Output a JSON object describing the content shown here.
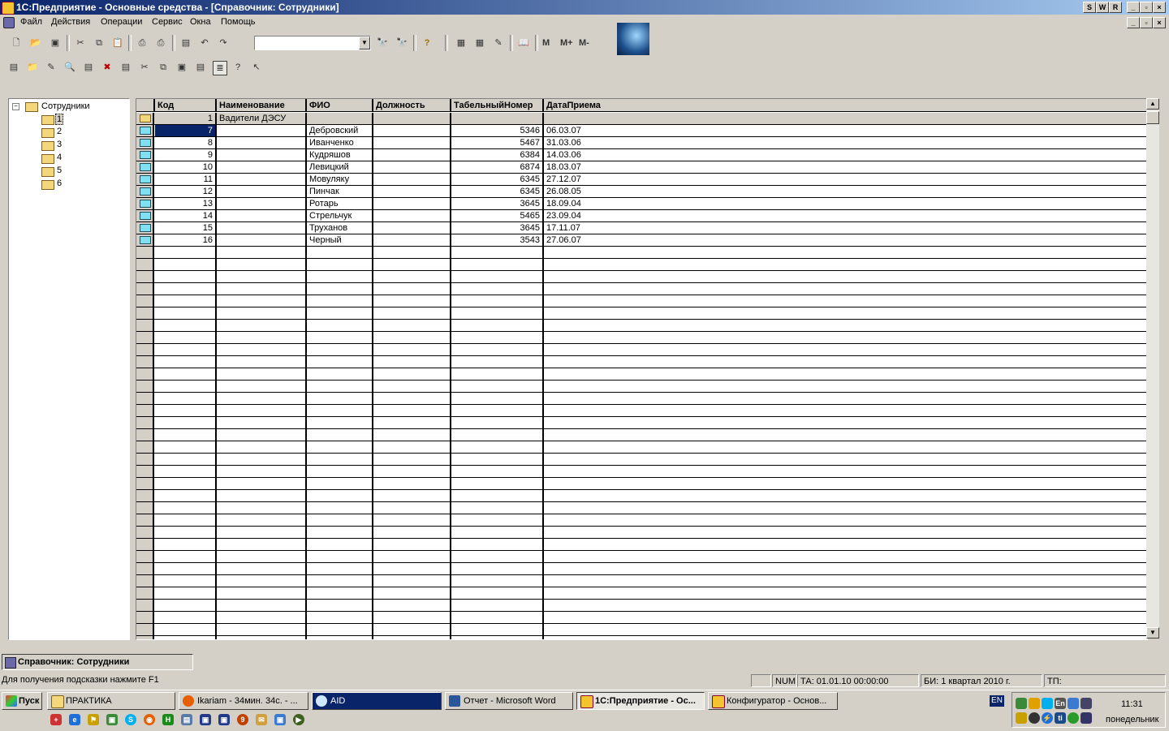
{
  "window": {
    "title": "1С:Предприятие - Основные средства - [Справочник: Сотрудники]",
    "controls": [
      "S",
      "W",
      "R"
    ]
  },
  "menu": [
    "Файл",
    "Действия",
    "Операции",
    "Сервис",
    "Окна",
    "Помощь"
  ],
  "toolbar": {
    "memory_buttons": [
      "M",
      "M+",
      "M-"
    ],
    "search_value": ""
  },
  "tree": {
    "root": "Сотрудники",
    "children": [
      "1",
      "2",
      "3",
      "4",
      "5",
      "6"
    ]
  },
  "grid": {
    "columns": [
      "Код",
      "Наименование",
      "ФИО",
      "Должность",
      "ТабельныйНомер",
      "ДатаПриема"
    ],
    "rows": [
      {
        "kod": "1",
        "name": "Вадители ДЭСУ",
        "fio": "",
        "dolzh": "",
        "tab": "",
        "date": "",
        "group": true
      },
      {
        "kod": "7",
        "name": "",
        "fio": "Дебровский",
        "dolzh": "",
        "tab": "5346",
        "date": "06.03.07"
      },
      {
        "kod": "8",
        "name": "",
        "fio": "Иванченко",
        "dolzh": "",
        "tab": "5467",
        "date": "31.03.06"
      },
      {
        "kod": "9",
        "name": "",
        "fio": "Кудряшов",
        "dolzh": "",
        "tab": "6384",
        "date": "14.03.06"
      },
      {
        "kod": "10",
        "name": "",
        "fio": "Левицкий",
        "dolzh": "",
        "tab": "6874",
        "date": "18.03.07"
      },
      {
        "kod": "11",
        "name": "",
        "fio": "Мовуляку",
        "dolzh": "",
        "tab": "6345",
        "date": "27.12.07"
      },
      {
        "kod": "12",
        "name": "",
        "fio": "Пинчак",
        "dolzh": "",
        "tab": "6345",
        "date": "26.08.05"
      },
      {
        "kod": "13",
        "name": "",
        "fio": "Ротарь",
        "dolzh": "",
        "tab": "3645",
        "date": "18.09.04"
      },
      {
        "kod": "14",
        "name": "",
        "fio": "Стрельчук",
        "dolzh": "",
        "tab": "5465",
        "date": "23.09.04"
      },
      {
        "kod": "15",
        "name": "",
        "fio": "Труханов",
        "dolzh": "",
        "tab": "3645",
        "date": "17.11.07"
      },
      {
        "kod": "16",
        "name": "",
        "fio": "Черный",
        "dolzh": "",
        "tab": "3543",
        "date": "27.06.07"
      }
    ]
  },
  "tab": {
    "label": "Справочник: Сотрудники"
  },
  "status": {
    "hint": "Для получения подсказки нажмите F1",
    "num": "NUM",
    "ta": "ТА: 01.01.10  00:00:00",
    "bi": "БИ: 1 квартал 2010 г.",
    "tp": "ТП:"
  },
  "taskbar": {
    "start": "Пуск",
    "tasks": [
      "ПРАКТИКА",
      "Ikariam - 34мин. 34с. - ...",
      "AID",
      "Отчет - Microsoft Word",
      "1С:Предприятие - Ос...",
      "Конфигуратор - Основ..."
    ],
    "lang": "EN",
    "time": "11:31",
    "day": "понедельник"
  }
}
